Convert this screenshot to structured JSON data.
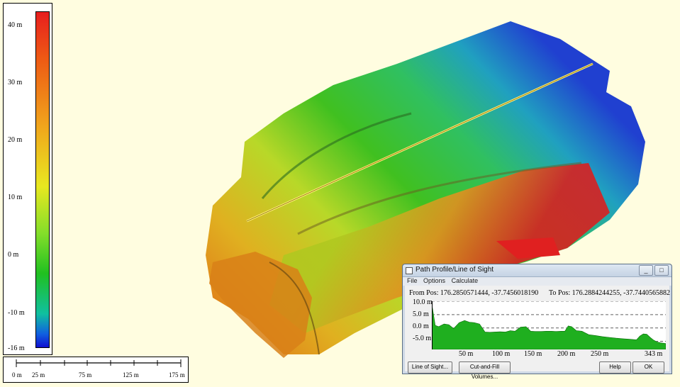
{
  "legend": {
    "labels": [
      {
        "text": "40 m",
        "value": 40
      },
      {
        "text": "30 m",
        "value": 30
      },
      {
        "text": "20 m",
        "value": 20
      },
      {
        "text": "10 m",
        "value": 10
      },
      {
        "text": "0 m",
        "value": 0
      },
      {
        "text": "-10 m",
        "value": -10
      },
      {
        "text": "-16 m",
        "value": -16
      }
    ]
  },
  "scale_bar": {
    "labels": [
      "0 m",
      "25 m",
      "75 m",
      "125 m",
      "175 m"
    ]
  },
  "dialog": {
    "title": "Path Profile/Line of Sight",
    "menu": {
      "file": "File",
      "options": "Options",
      "calculate": "Calculate"
    },
    "from_pos": "From Pos: 176.2850571444, -37.7456018190",
    "to_pos": "To Pos: 176.2884244255, -37.7440565882",
    "y_labels": [
      "10.0 m",
      "5.0 m",
      "0.0 m",
      "-5.0 m"
    ],
    "x_labels": [
      "50 m",
      "100 m",
      "150 m",
      "200 m",
      "250 m",
      "343 m"
    ],
    "buttons": {
      "line_of_sight": "Line of Sight...",
      "cut_fill": "Cut-and-Fill Volumes...",
      "help": "Help",
      "ok": "OK"
    },
    "window_buttons": {
      "minimize": "_",
      "maximize": "□",
      "close": "✕"
    }
  },
  "chart_data": {
    "type": "area",
    "x": [
      0,
      5,
      10,
      18,
      25,
      32,
      40,
      48,
      55,
      62,
      70,
      78,
      85,
      92,
      100,
      108,
      115,
      122,
      130,
      138,
      145,
      152,
      160,
      168,
      175,
      182,
      190,
      195,
      200,
      205,
      212,
      220,
      230,
      240,
      250,
      260,
      270,
      280,
      290,
      300,
      305,
      310,
      315,
      320,
      325,
      330,
      335,
      343
    ],
    "y": [
      9,
      1,
      0.5,
      1.5,
      1.2,
      -0.2,
      2,
      2.8,
      2.2,
      2,
      1.5,
      -1.5,
      -1.6,
      -1.5,
      -1.4,
      -1.5,
      -1,
      -1.2,
      0.3,
      0.5,
      -1.2,
      -1.3,
      -1.3,
      -1.2,
      -1.2,
      -1.3,
      -1.2,
      -1.2,
      0.8,
      0.5,
      -1,
      -1.2,
      -2.5,
      -2.8,
      -3.2,
      -3.5,
      -3.8,
      -4,
      -4.2,
      -4.4,
      -3,
      -2.2,
      -2.3,
      -3.5,
      -4.5,
      -5.2,
      -5.5,
      -5.8
    ],
    "xlim": [
      0,
      343
    ],
    "ylim": [
      -8,
      10
    ],
    "yticks": [
      10,
      5,
      0,
      -5
    ],
    "grid": true
  },
  "colors": {
    "background": "#fffde0",
    "profile_fill": "#1faf1f",
    "path_line": "#fff07a"
  }
}
